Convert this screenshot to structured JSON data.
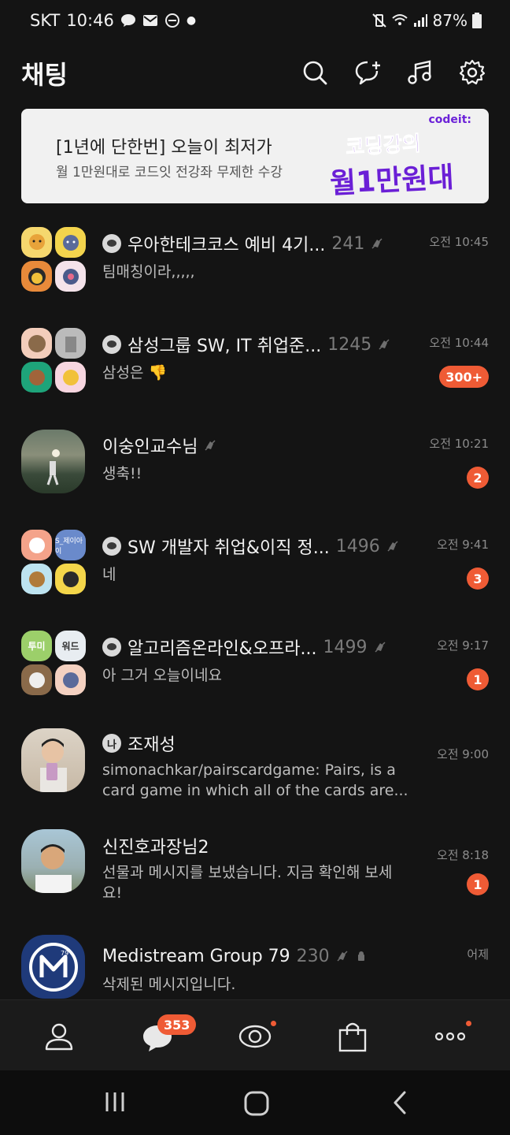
{
  "status_bar": {
    "carrier": "SKT",
    "time": "10:46",
    "battery": "87%"
  },
  "header": {
    "title": "채팅",
    "icons": [
      "search-icon",
      "new-chat-icon",
      "music-icon",
      "settings-icon"
    ]
  },
  "banner": {
    "title": "[1년에 단한번] 오늘이 최저가",
    "subtitle": "월 1만원대로 코드잇 전강좌 무제한 수강",
    "brand": "codeit:",
    "promo_line1": "코딩강의",
    "promo_line2": "월1만원대"
  },
  "chats": [
    {
      "name": "우아한테크코스 예비 4기...",
      "count": "241",
      "muted": true,
      "preview": "팀매칭이라,,,,,",
      "time": "오전 10:45",
      "badge": "",
      "group": true
    },
    {
      "name": "삼성그룹 SW, IT 취업준...",
      "count": "1245",
      "muted": true,
      "preview": "삼성은 👎",
      "time": "오전 10:44",
      "badge": "300+",
      "group": true
    },
    {
      "name": "이숭인교수님",
      "count": "",
      "muted": true,
      "preview": "생축!!",
      "time": "오전 10:21",
      "badge": "2",
      "group": false
    },
    {
      "name": "SW 개발자 취업&이직 정...",
      "count": "1496",
      "muted": true,
      "preview": "네",
      "time": "오전 9:41",
      "badge": "3",
      "group": true
    },
    {
      "name": "알고리즘온라인&오프라...",
      "count": "1499",
      "muted": true,
      "preview": "아 그거 오늘이네요",
      "time": "오전 9:17",
      "badge": "1",
      "group": true
    },
    {
      "name": "조재성",
      "count": "",
      "muted": false,
      "me_label": "나",
      "preview": "simonachkar/pairscardgame: Pairs, is a card game in which all of the cards are...",
      "time": "오전 9:00",
      "badge": "",
      "group": false
    },
    {
      "name": "신진호과장님2",
      "count": "",
      "muted": false,
      "preview": "선물과 메시지를 보냈습니다. 지금 확인해 보세요!",
      "time": "오전 8:18",
      "badge": "1",
      "group": false
    },
    {
      "name": "Medistream Group 79",
      "count": "230",
      "muted": true,
      "preview": "삭제된 메시지입니다.",
      "time": "어제",
      "badge": "",
      "group": false
    }
  ],
  "avatar_labels": {
    "chat4_tr": "S_제이아이",
    "chat5_tl": "투미",
    "chat5_tr": "워드",
    "chat8_logo_num": "79"
  },
  "bottom_nav": {
    "chat_badge": "353",
    "icons": [
      "friends-icon",
      "chats-icon",
      "openchat-icon",
      "shopping-icon",
      "more-icon"
    ]
  },
  "colors": {
    "background": "#141414",
    "accent_badge": "#ef5b35",
    "promo_purple": "#6b1fd6"
  }
}
